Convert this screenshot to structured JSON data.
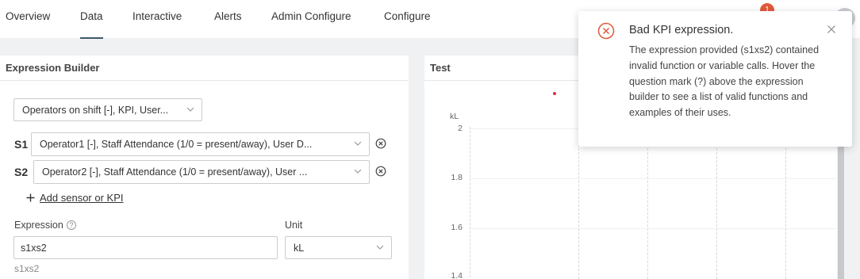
{
  "nav": {
    "tabs": [
      {
        "label": "Overview"
      },
      {
        "label": "Data"
      },
      {
        "label": "Interactive"
      },
      {
        "label": "Alerts"
      },
      {
        "label": "Admin Configure"
      },
      {
        "label": "Configure"
      }
    ],
    "active_tab": "Data",
    "notification_count": "1"
  },
  "builder": {
    "title": "Expression Builder",
    "source_select": "Operators on shift [-], KPI, User...",
    "sensors": [
      {
        "id": "S1",
        "value": "Operator1 [-], Staff Attendance (1/0 = present/away), User D..."
      },
      {
        "id": "S2",
        "value": "Operator2 [-], Staff Attendance (1/0 = present/away), User ..."
      }
    ],
    "add_link": "Add sensor or KPI",
    "expression_label": "Expression",
    "expression_value": "s1xs2",
    "unit_label": "Unit",
    "unit_value": "kL",
    "preview": "s1xs2"
  },
  "test": {
    "title": "Test",
    "unit": "kL",
    "yticks": [
      "2",
      "1.8",
      "1.6",
      "1.4"
    ]
  },
  "toast": {
    "title": "Bad KPI expression.",
    "body": "The expression provided (s1xs2) contained invalid function or variable calls. Hover the question mark (?) above the expression builder to see a list of valid functions and examples of their uses."
  },
  "colors": {
    "error": "#e05a3a",
    "accent_underline": "#3a5a6a"
  }
}
